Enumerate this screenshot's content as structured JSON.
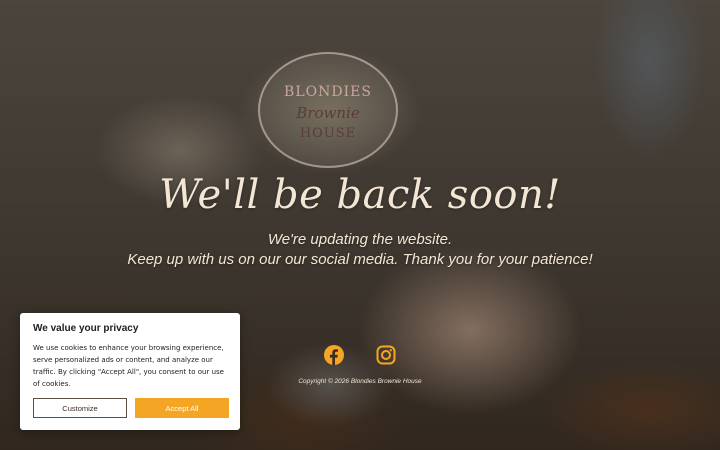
{
  "logo": {
    "line1": "BLONDIES",
    "line2": "Brownie",
    "line3": "HOUSE"
  },
  "hero": {
    "headline": "We'll be back soon!",
    "line1": "We're updating the website.",
    "line2": "Keep up with us on our our social media. Thank you for your patience!"
  },
  "social": {
    "icons": [
      "facebook-icon",
      "instagram-icon"
    ],
    "color": "#f5a524"
  },
  "footer": {
    "copyright": "Copyright © 2026 Blondies Brownie House"
  },
  "cookie_banner": {
    "title": "We value your privacy",
    "body": "We use cookies to enhance your browsing experience, serve personalized ads or content, and analyze our traffic. By clicking \"Accept All\", you consent to our use of cookies.",
    "customize_label": "Customize",
    "accept_label": "Accept All",
    "accent_color": "#f5a524"
  }
}
